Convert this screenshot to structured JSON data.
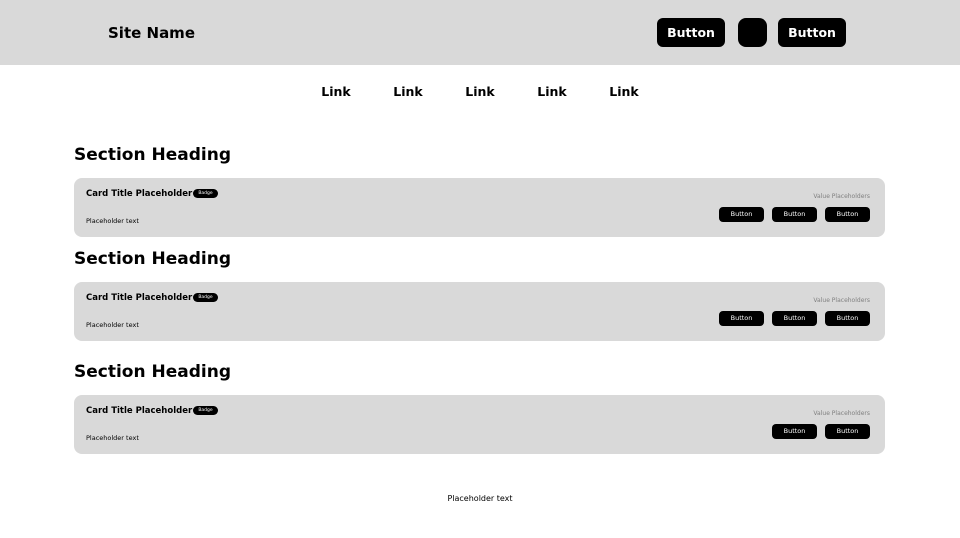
{
  "header": {
    "site_name": "Site Name",
    "button_1": "Button",
    "button_2": "Button"
  },
  "nav": {
    "links": [
      "Link",
      "Link",
      "Link",
      "Link",
      "Link"
    ]
  },
  "sections": [
    {
      "heading": "Section Heading",
      "card": {
        "title": "Card Title Placeholder",
        "badge": "Badge",
        "text": "Placeholder text",
        "value": "Value Placeholders",
        "buttons": [
          "Button",
          "Button",
          "Button"
        ]
      }
    },
    {
      "heading": "Section Heading",
      "card": {
        "title": "Card Title Placeholder",
        "badge": "Badge",
        "text": "Placeholder text",
        "value": "Value Placeholders",
        "buttons": [
          "Button",
          "Button",
          "Button"
        ]
      }
    },
    {
      "heading": "Section Heading",
      "card": {
        "title": "Card Title Placeholder",
        "badge": "Badge",
        "text": "Placeholder text",
        "value": "Value Placeholders",
        "buttons": [
          "Button",
          "Button"
        ]
      }
    }
  ],
  "footer": {
    "text": "Placeholder text"
  },
  "colors": {
    "header_bg": "#d9d9d9",
    "card_bg": "#d9d9d9",
    "button_bg": "#000000",
    "button_text": "#ffffff",
    "muted_text": "#808080"
  }
}
